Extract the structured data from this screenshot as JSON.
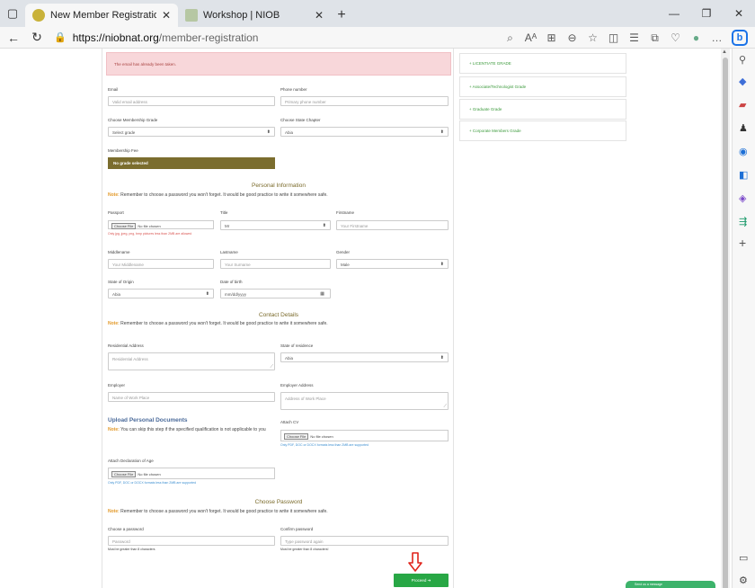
{
  "browser": {
    "tabs": [
      {
        "title": "New Member Registration | Step",
        "active": true
      },
      {
        "title": "Workshop | NIOB",
        "active": false
      }
    ],
    "url_host": "https://niobnat.org",
    "url_path": "/member-registration"
  },
  "form": {
    "alert_text": "The email has already been taken.",
    "email": {
      "label": "Email",
      "placeholder": "Valid email address"
    },
    "phone": {
      "label": "Phone number",
      "placeholder": "Primary phone number"
    },
    "membership_grade": {
      "label": "Choose Membership Grade",
      "value": "Select grade"
    },
    "state_chapter": {
      "label": "Choose State Chapter",
      "value": "Abia"
    },
    "membership_fee": {
      "label": "Membership Fee",
      "value": "No grade selected"
    },
    "personal": {
      "title": "Personal Information",
      "note_label": "Note:",
      "note_text": " Remember to choose a password you won't forget. It would be good practice to write it somewhere safe.",
      "passport_label": "Passport",
      "choose_file": "Choose File",
      "no_file": "No file chosen",
      "passport_hint": "Only jpg, jpeg, png, bmp pictures less than 2MB are allowed",
      "title_label": "Title",
      "title_value": "Mr",
      "firstname_label": "Firstname",
      "firstname_placeholder": "Your Firstname",
      "middlename_label": "Middlename",
      "middlename_placeholder": "Your Middlename",
      "lastname_label": "Lastname",
      "lastname_placeholder": "Your Surname",
      "gender_label": "Gender",
      "gender_value": "Male",
      "origin_label": "State of Origin",
      "origin_value": "Abia",
      "dob_label": "Date of birth",
      "dob_placeholder": "mm/dd/yyyy"
    },
    "contact": {
      "title": "Contact Details",
      "note_label": "Note:",
      "note_text": " Remember to choose a password you won't forget. It would be good practice to write it somewhere safe.",
      "address_label": "Residential Address",
      "address_placeholder": "Residential Address",
      "residence_label": "State of residence",
      "residence_value": "Abia",
      "employer_label": "Employer",
      "employer_placeholder": "Name of Work Place",
      "employer_address_label": "Employer Address",
      "employer_address_placeholder": "Address of Work Place"
    },
    "upload": {
      "title": "Upload Personal Documents",
      "note_label": "Note:",
      "note_text": " You can skip this step if the specified qualification is not applicable to you",
      "cv_label": "Attach CV",
      "cv_hint": "Only PDF, DOC or DOCX formats less than 2MB are supported",
      "age_label": "Attach Declaration of Age",
      "age_hint": "Only PDF, DOC or DOCX formats less than 2MB are supported",
      "choose_file": "Choose File",
      "no_file": "No file chosen"
    },
    "password": {
      "title": "Choose Password",
      "note_label": "Note:",
      "note_text": " Remember to choose a password you won't forget. It would be good practice to write it somewhere safe.",
      "choose_label": "Choose a password",
      "choose_placeholder": "Password",
      "choose_hint": "Must be greater than 8 characters",
      "confirm_label": "Confirm password",
      "confirm_placeholder": "Type password again",
      "confirm_hint": "Must be greater than 8 characters!"
    },
    "proceed_label": "Proceed ➔"
  },
  "grades": [
    "+ LICENTIATE GRADE",
    "+ Associate/Technologist Grade",
    "+ Graduate Grade",
    "+ Corporate Members Grade"
  ],
  "share_label": "Send us a message"
}
